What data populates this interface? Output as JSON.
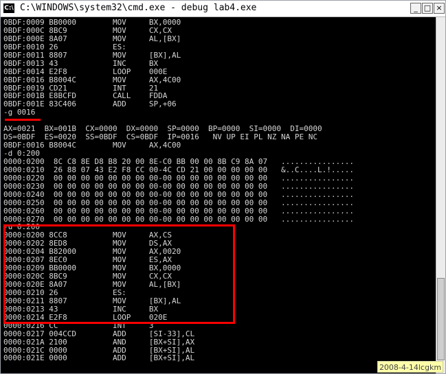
{
  "window": {
    "title": "C:\\WINDOWS\\system32\\cmd.exe - debug lab4.exe",
    "icon_label": "C:\\"
  },
  "controls": {
    "minimize": "_",
    "maximize": "□",
    "close": "×"
  },
  "lines": [
    "0BDF:0009 BB0000        MOV     BX,0000",
    "0BDF:000C 8BC9          MOV     CX,CX",
    "0BDF:000E 8A07          MOV     AL,[BX]",
    "0BDF:0010 26            ES:",
    "0BDF:0011 8807          MOV     [BX],AL",
    "0BDF:0013 43            INC     BX",
    "0BDF:0014 E2F8          LOOP    000E",
    "0BDF:0016 B8004C        MOV     AX,4C00",
    "0BDF:0019 CD21          INT     21",
    "0BDF:001B E8BCFD        CALL    FDDA",
    "0BDF:001E 83C406        ADD     SP,+06",
    "-g 0016",
    "",
    "AX=0021  BX=001B  CX=0000  DX=0000  SP=0000  BP=0000  SI=0000  DI=0000",
    "DS=0BDF  ES=0020  SS=0BDF  CS=0BDF  IP=0016   NV UP EI PL NZ NA PE NC",
    "0BDF:0016 B8004C        MOV     AX,4C00",
    "-d 0:200",
    "0000:0200  8C C8 8E D8 B8 20 00 8E-C0 BB 00 00 8B C9 8A 07   ................",
    "0000:0210  26 88 07 43 E2 F8 CC 00-4C CD 21 00 00 00 00 00   &..C....L.!.....",
    "0000:0220  00 00 00 00 00 00 00 00-00 00 00 00 00 00 00 00   ................",
    "0000:0230  00 00 00 00 00 00 00 00-00 00 00 00 00 00 00 00   ................",
    "0000:0240  00 00 00 00 00 00 00 00-00 00 00 00 00 00 00 00   ................",
    "0000:0250  00 00 00 00 00 00 00 00-00 00 00 00 00 00 00 00   ................",
    "0000:0260  00 00 00 00 00 00 00 00-00 00 00 00 00 00 00 00   ................",
    "0000:0270  00 00 00 00 00 00 00 00-00 00 00 00 00 00 00 00   ................",
    "-u 0:200",
    "0000:0200 8CC8          MOV     AX,CS",
    "0000:0202 8ED8          MOV     DS,AX",
    "0000:0204 B82000        MOV     AX,0020",
    "0000:0207 8EC0          MOV     ES,AX",
    "0000:0209 BB0000        MOV     BX,0000",
    "0000:020C 8BC9          MOV     CX,CX",
    "0000:020E 8A07          MOV     AL,[BX]",
    "0000:0210 26            ES:",
    "0000:0211 8807          MOV     [BX],AL",
    "0000:0213 43            INC     BX",
    "0000:0214 E2F8          LOOP    020E",
    "0000:0216 CC            INT     3",
    "0000:0217 004CCD        ADD     [SI-33],CL",
    "0000:021A 2100          AND     [BX+SI],AX",
    "0000:021C 0000          ADD     [BX+SI],AL",
    "0000:021E 0000          ADD     [BX+SI],AL"
  ],
  "watermark": "2008-4-14lcgkm",
  "colors": {
    "console_bg": "#000000",
    "console_text": "#d7d7d7",
    "annotation": "#ff0000",
    "watermark_bg": "#ffffaa"
  }
}
